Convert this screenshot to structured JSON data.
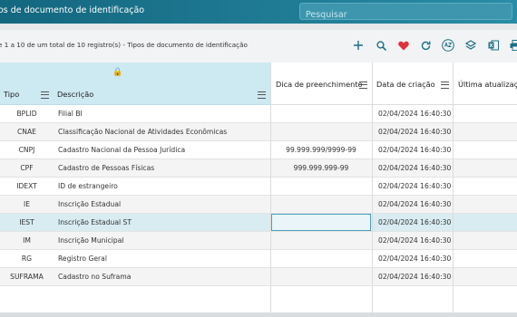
{
  "header": {
    "title": "os de documento de identificação",
    "search_placeholder": "Pesquisar"
  },
  "toolbar": {
    "info": "e 1 a 10 de um total de 10 registro(s) - Tipos de documento de identificação",
    "icons": [
      "plus-icon",
      "search-icon",
      "heart-icon",
      "refresh-icon",
      "sort-az-icon",
      "layers-icon",
      "excel-icon",
      "print-icon"
    ],
    "heart_color": "#e0303a",
    "accent_color": "#1c6f86"
  },
  "columns": {
    "tipo": "Tipo",
    "descricao": "Descrição",
    "dica": "Dica de preenchimento",
    "data": "Data de criação",
    "ultima": "Última atualizaçã"
  },
  "rows": [
    {
      "tipo": "BPLID",
      "descricao": "Filial BI",
      "dica": "",
      "data": "02/04/2024 16:40:30"
    },
    {
      "tipo": "CNAE",
      "descricao": "Classificação Nacional de Atividades Econômicas",
      "dica": "",
      "data": "02/04/2024 16:40:30"
    },
    {
      "tipo": "CNPJ",
      "descricao": "Cadastro Nacional da Pessoa Jurídica",
      "dica": "99.999.999/9999-99",
      "data": "02/04/2024 16:40:30"
    },
    {
      "tipo": "CPF",
      "descricao": "Cadastro de Pessoas Físicas",
      "dica": "999.999.999-99",
      "data": "02/04/2024 16:40:30"
    },
    {
      "tipo": "IDEXT",
      "descricao": "ID de estrangeiro",
      "dica": "",
      "data": "02/04/2024 16:40:30"
    },
    {
      "tipo": "IE",
      "descricao": "Inscrição Estadual",
      "dica": "",
      "data": "02/04/2024 16:40:30"
    },
    {
      "tipo": "IEST",
      "descricao": "Inscrição Estadual ST",
      "dica": "",
      "data": "02/04/2024 16:40:30"
    },
    {
      "tipo": "IM",
      "descricao": "Inscrição Municipal",
      "dica": "",
      "data": "02/04/2024 16:40:30"
    },
    {
      "tipo": "RG",
      "descricao": "Registro Geral",
      "dica": "",
      "data": "02/04/2024 16:40:30"
    },
    {
      "tipo": "SUFRAMA",
      "descricao": "Cadastro no Suframa",
      "dica": "",
      "data": "02/04/2024 16:40:30"
    }
  ],
  "selected_row": 6
}
